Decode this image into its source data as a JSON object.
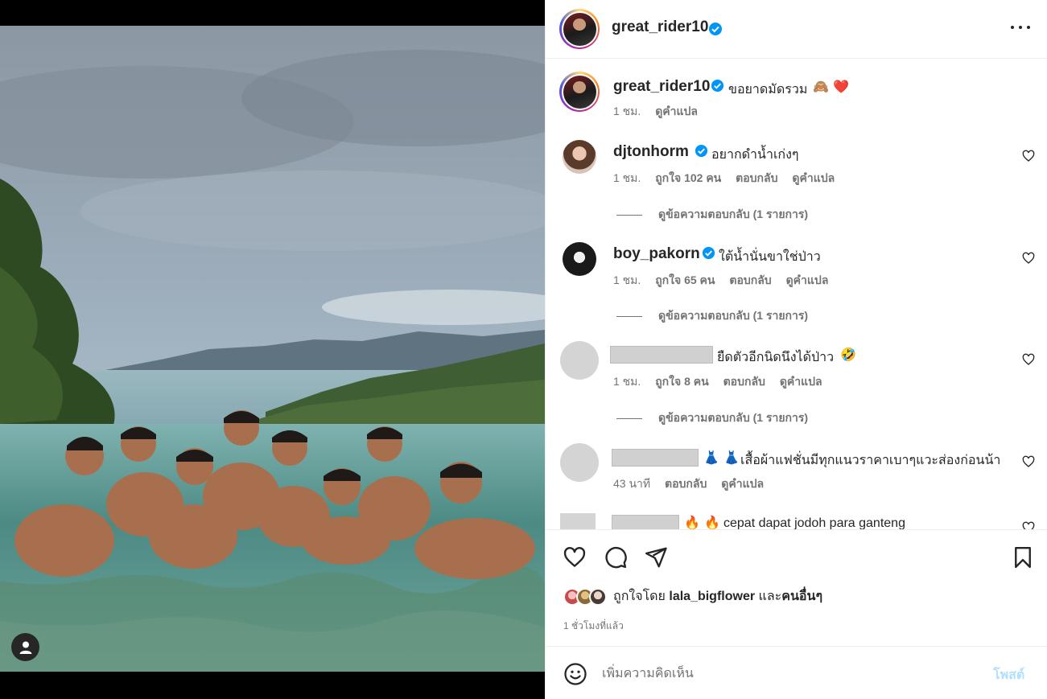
{
  "post": {
    "username": "great_rider10",
    "caption": "ขอยาดมัดรวม",
    "caption_emoji": "🙈 ❤️",
    "caption_time": "1 ชม.",
    "see_translation": "ดูคำแปล"
  },
  "comments": [
    {
      "username": "djtonhorm",
      "verified": true,
      "text": "อยากดำน้ำเก่งๆ",
      "time": "1 ชม.",
      "likes": "ถูกใจ 102 คน",
      "reply": "ตอบกลับ",
      "translate": "ดูคำแปล",
      "view_replies": "ดูข้อความตอบกลับ (1 รายการ)"
    },
    {
      "username": "boy_pakorn",
      "verified": true,
      "text": "ใต้น้ำนั่นขาใช่ป่าว",
      "time": "1 ชม.",
      "likes": "ถูกใจ 65 คน",
      "reply": "ตอบกลับ",
      "translate": "ดูคำแปล",
      "view_replies": "ดูข้อความตอบกลับ (1 รายการ)"
    },
    {
      "username": "",
      "text": "ยืดตัวอีกนิดนึงได้ป่าว",
      "text_emoji": "🤣",
      "time": "1 ชม.",
      "likes": "ถูกใจ 8 คน",
      "reply": "ตอบกลับ",
      "translate": "ดูคำแปล",
      "view_replies": "ดูข้อความตอบกลับ (1 รายการ)"
    },
    {
      "username": "",
      "text_emoji": "👗 👗",
      "text": "เสื้อผ้าแฟชั่นมีทุกแนวราคาเบาๆแวะส่องก่อนน้า",
      "time": "43 นาที",
      "reply": "ตอบกลับ",
      "translate": "ดูคำแปล"
    },
    {
      "username": "",
      "text_emoji": "🔥 🔥",
      "text": "cepat dapat jodoh para ganteng"
    }
  ],
  "likes": {
    "prefix": "ถูกใจโดย",
    "user": "lala_bigflower",
    "joiner": "และ",
    "others": "คนอื่นๆ"
  },
  "post_time": "1 ชั่วโมงที่แล้ว",
  "comment_box": {
    "placeholder": "เพิ่มความคิดเห็น",
    "post_label": "โพสต์"
  },
  "colors": {
    "verified": "#0095f6",
    "post_button_disabled": "#b2dffc",
    "secondary_text": "#737373"
  },
  "icons": {
    "more": "more-options-icon",
    "like": "heart-icon",
    "comment": "comment-icon",
    "share": "share-icon",
    "save": "bookmark-icon",
    "emoji": "emoji-icon",
    "tag": "user-tag-icon"
  }
}
